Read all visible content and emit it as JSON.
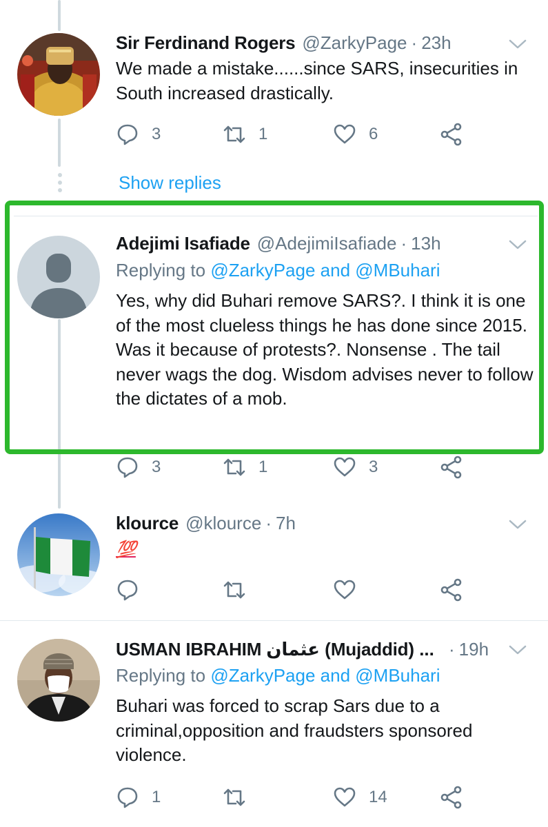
{
  "tweets": [
    {
      "name": "Sir Ferdinand Rogers",
      "handle": "@ZarkyPage",
      "dot": "·",
      "time": "23h",
      "text": "We made a mistake......since SARS, insecurities in South increased drastically.",
      "replies": "3",
      "retweets": "1",
      "likes": "6",
      "show_replies": "Show replies"
    },
    {
      "name": "Adejimi Isafiade",
      "handle": "@AdejimiIsafiade",
      "dot": "·",
      "time": "13h",
      "replying_prefix": "Replying to ",
      "replying_to_1": "@ZarkyPage",
      "replying_and": " and ",
      "replying_to_2": "@MBuhari",
      "text": "Yes, why did Buhari remove SARS?. I think it is one of the most clueless things he has done since 2015. Was it because of protests?. Nonsense . The tail never wags the dog. Wisdom advises never to follow the dictates of a mob.",
      "replies": "3",
      "retweets": "1",
      "likes": "3"
    },
    {
      "name": "klource",
      "handle": "@klource",
      "dot": "·",
      "time": "7h",
      "text": "💯",
      "replies": "",
      "retweets": "",
      "likes": ""
    },
    {
      "name": "USMAN IBRAHIM عثمان (Mujaddid) ...",
      "handle": "",
      "dot": "·",
      "time": "19h",
      "replying_prefix": "Replying to ",
      "replying_to_1": "@ZarkyPage",
      "replying_and": " and ",
      "replying_to_2": "@MBuhari",
      "text": "Buhari was forced to scrap Sars due to a criminal,opposition and fraudsters sponsored violence.",
      "replies": "1",
      "retweets": "",
      "likes": "14"
    }
  ],
  "colors": {
    "accent": "#1da1f2",
    "muted": "#657786",
    "highlight": "#2db82d",
    "thread_line": "#cfd9de"
  },
  "icons": {
    "reply": "reply-icon",
    "retweet": "retweet-icon",
    "like": "heart-icon",
    "share": "share-icon",
    "menu": "chevron-down-icon"
  }
}
